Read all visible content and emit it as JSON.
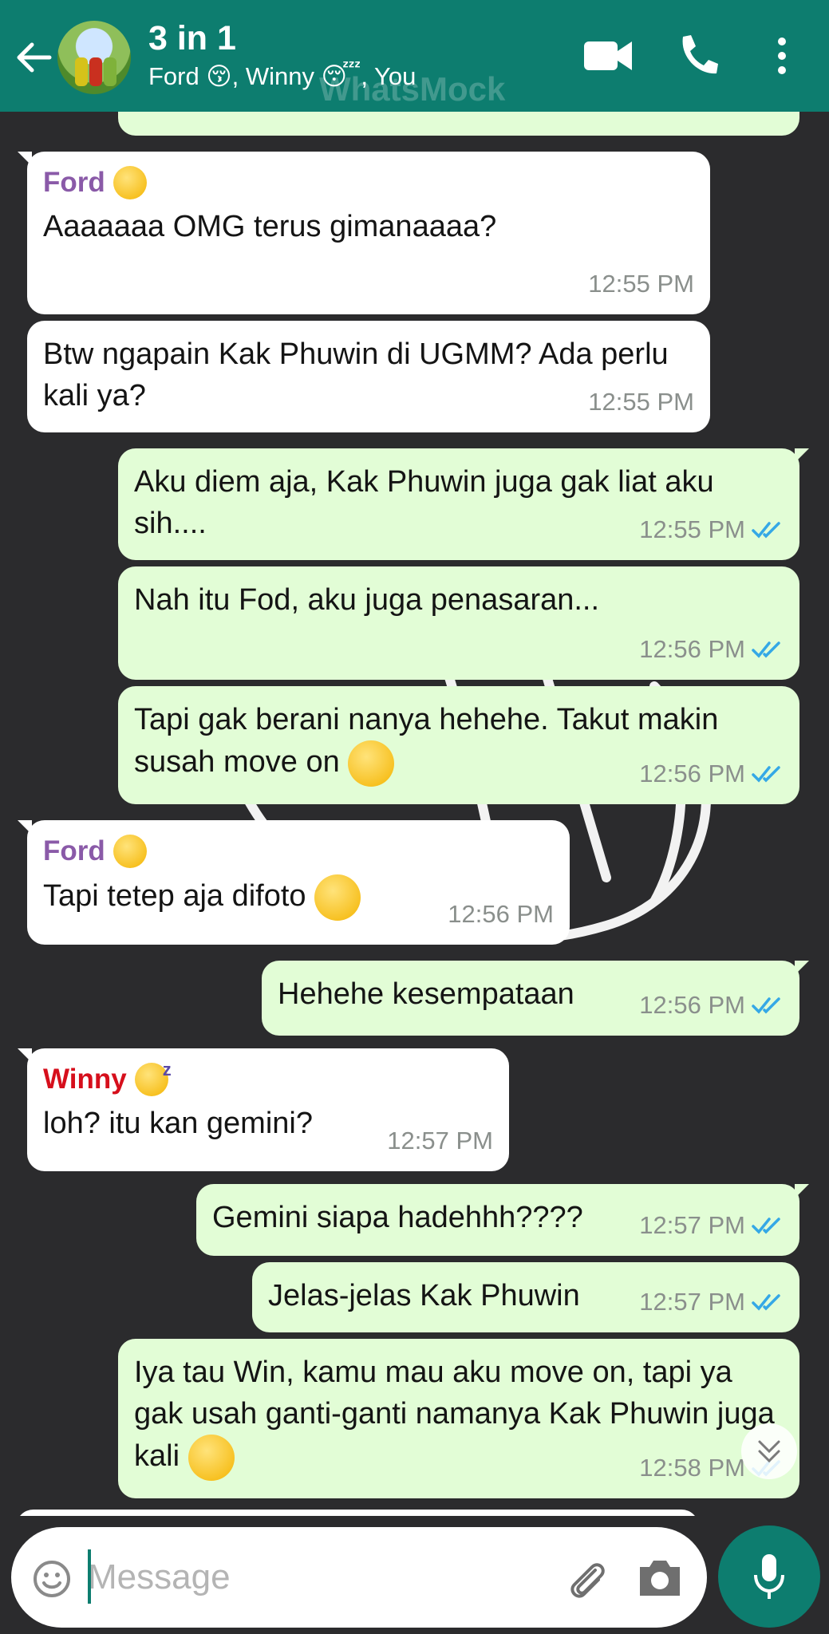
{
  "header": {
    "title": "3 in 1",
    "subtitle": "Ford 😚, Winny 😴, You",
    "watermark": "WhatsMock"
  },
  "messages": [
    {
      "sender": "Ford",
      "text": "Aaaaaaa OMG terus gimanaaaa?",
      "time": "12:55 PM"
    },
    {
      "text": "Btw ngapain Kak Phuwin di UGMM? Ada perlu kali ya?",
      "time": "12:55 PM"
    },
    {
      "text": "Aku diem aja, Kak Phuwin juga gak liat aku sih....",
      "time": "12:55 PM"
    },
    {
      "text": "Nah itu Fod, aku juga penasaran...",
      "time": "12:56 PM"
    },
    {
      "text": "Tapi gak berani nanya hehehe. Takut makin susah move on",
      "time": "12:56 PM"
    },
    {
      "sender": "Ford",
      "text": "Tapi tetep aja difoto",
      "time": "12:56 PM"
    },
    {
      "text": "Hehehe kesempataan",
      "time": "12:56 PM"
    },
    {
      "sender": "Winny",
      "text": "loh? itu kan gemini?",
      "time": "12:57 PM"
    },
    {
      "text": "Gemini siapa hadehhh????",
      "time": "12:57 PM"
    },
    {
      "text": "Jelas-jelas Kak Phuwin",
      "time": "12:57 PM"
    },
    {
      "text": "Iya tau Win, kamu mau aku move on, tapi ya gak usah ganti-ganti namanya Kak Phuwin juga kali",
      "time": "12:58 PM"
    }
  ],
  "input": {
    "placeholder": "Message"
  },
  "colors": {
    "header": "#0d7d6f",
    "outgoing": "#e2fdd6",
    "incoming": "#ffffff",
    "ford": "#8a5aa8",
    "winny": "#d60f1c",
    "read_tick": "#35a8e6"
  }
}
